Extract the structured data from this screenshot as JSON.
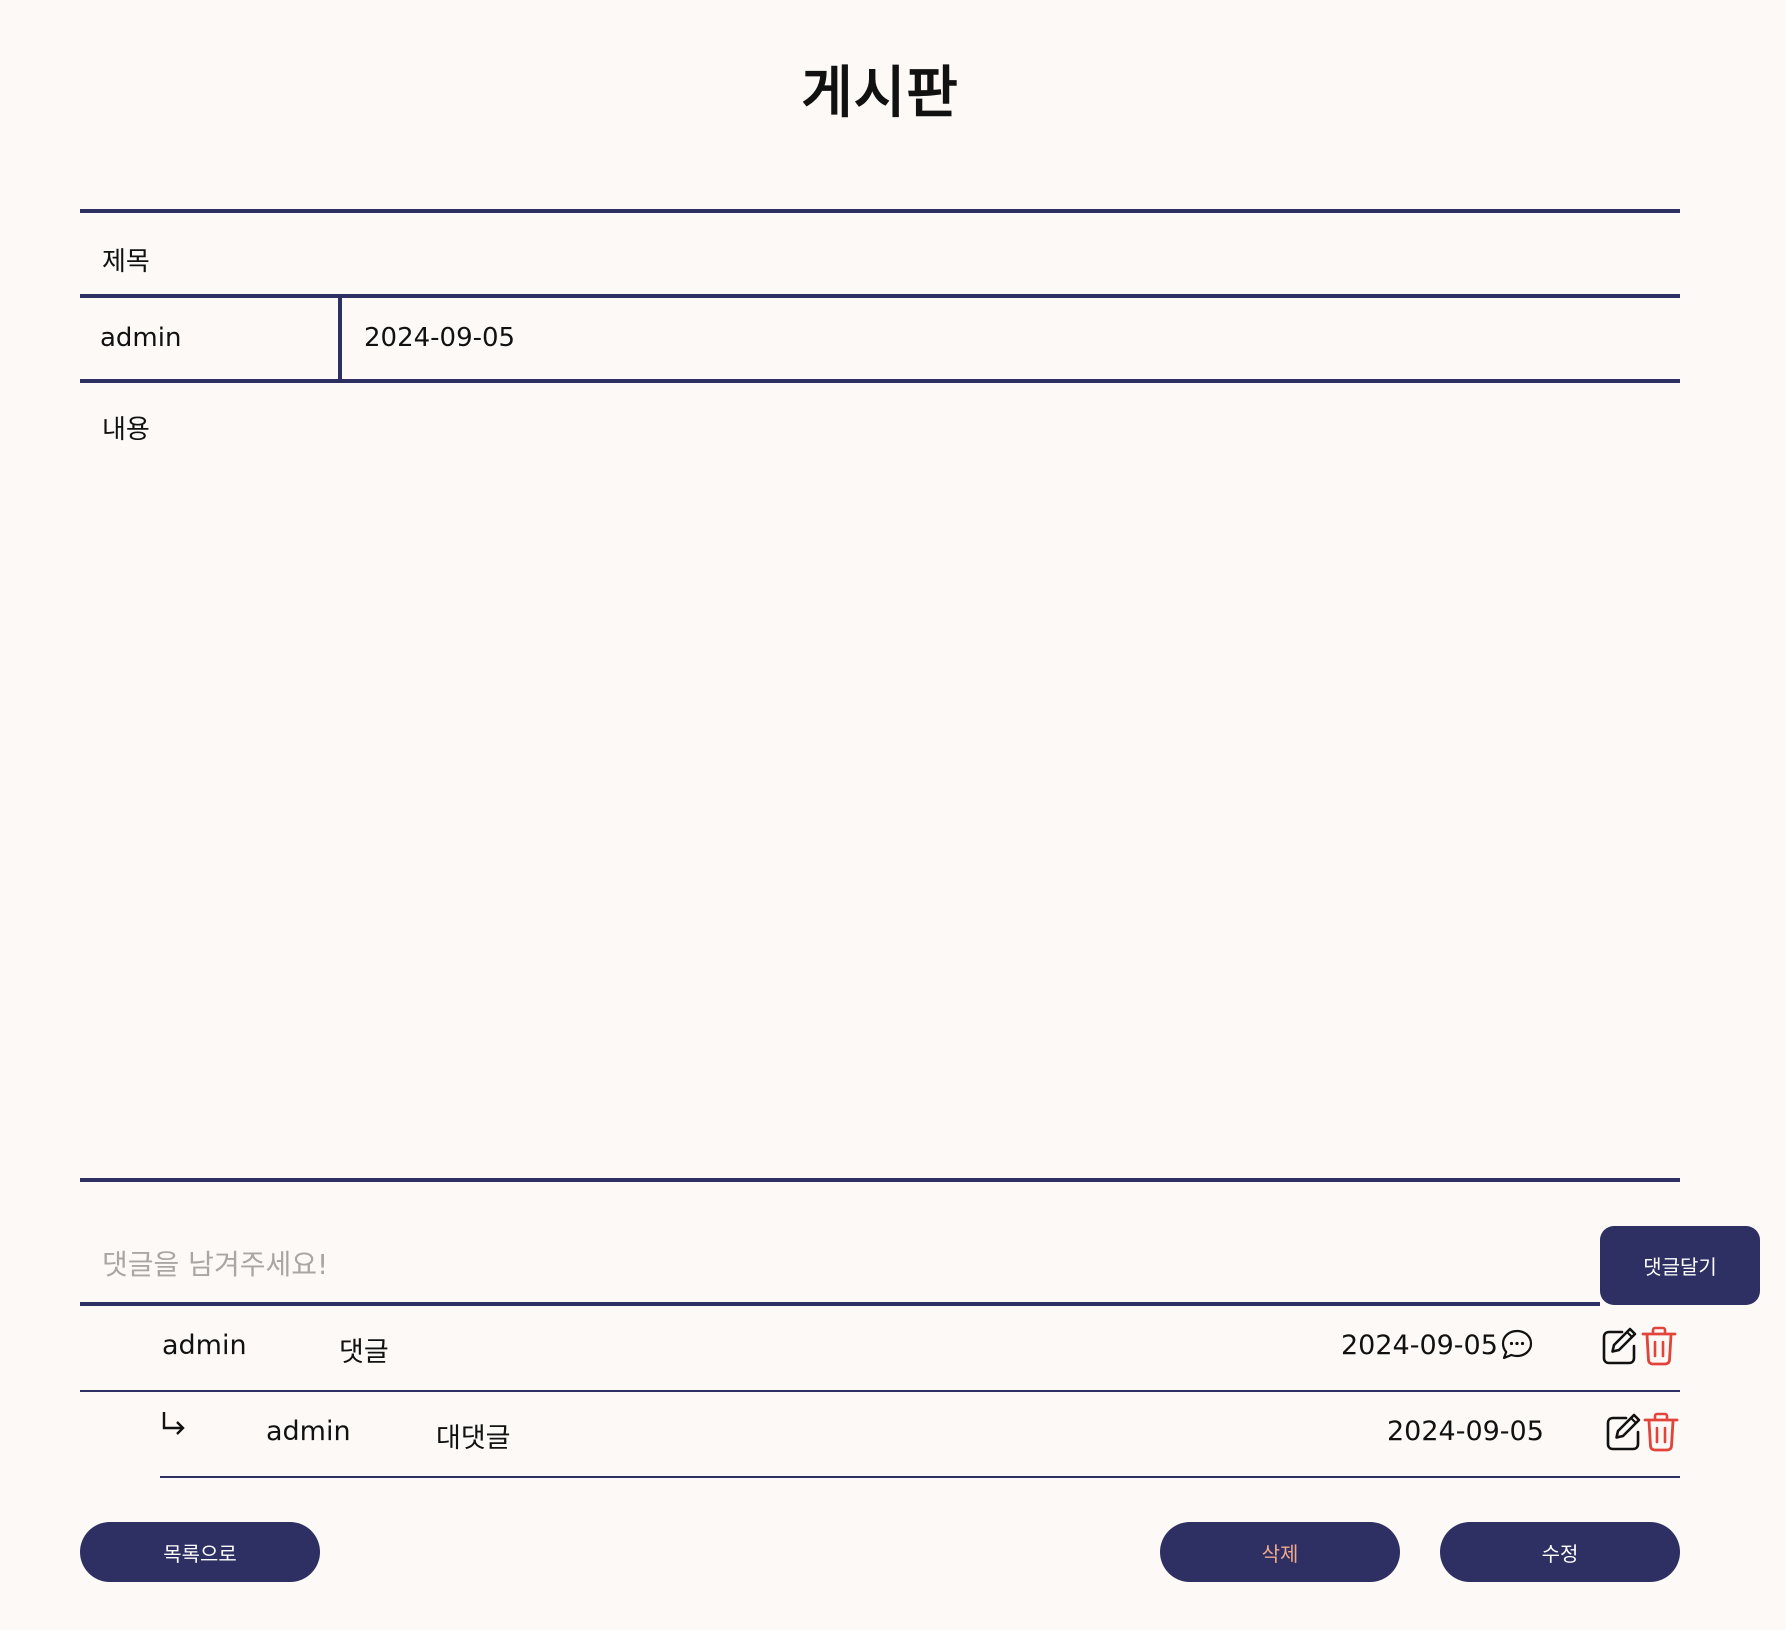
{
  "page": {
    "title": "게시판"
  },
  "post": {
    "title": "제목",
    "author": "admin",
    "date": "2024-09-05",
    "content": "내용"
  },
  "comment_form": {
    "placeholder": "댓글을 남겨주세요!",
    "submit_label": "댓글달기"
  },
  "comments": [
    {
      "author": "admin",
      "text": "댓글",
      "date": "2024-09-05",
      "icons": [
        "chat-bubble-icon",
        "edit-icon",
        "trash-icon"
      ]
    },
    {
      "author": "admin",
      "text": "대댓글",
      "date": "2024-09-05",
      "reply_marker": "↳",
      "icons": [
        "edit-icon",
        "trash-icon"
      ]
    }
  ],
  "actions": {
    "list_label": "목록으로",
    "delete_label": "삭제",
    "edit_label": "수정"
  },
  "colors": {
    "primary": "#2e2f63",
    "background": "#fcf9f6",
    "delete_text": "#f0a98c",
    "trash_icon": "#e0443a",
    "placeholder": "#a9a6a3"
  }
}
